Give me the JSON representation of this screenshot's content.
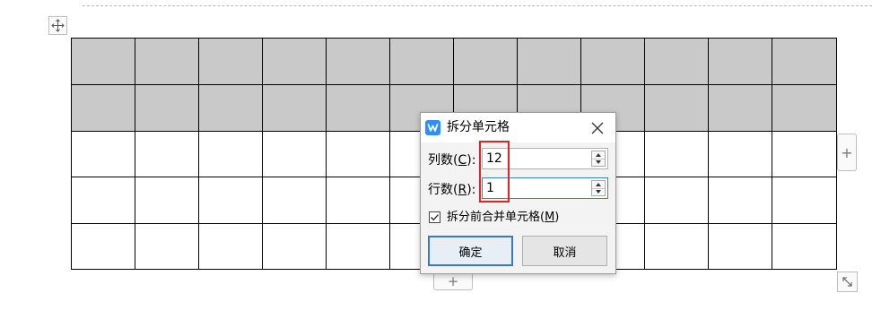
{
  "table": {
    "columns": 12,
    "rows": 5,
    "shaded_rows": 2,
    "shade_color": "#c9c9c9"
  },
  "handles": {
    "move_icon": "move-arrows-icon",
    "add_column_symbol": "+",
    "add_row_symbol": "+",
    "resize_icon": "resize-arrows-icon"
  },
  "dialog": {
    "title": "拆分单元格",
    "app_icon": "wps-writer-icon",
    "close_icon": "close-icon",
    "columns_label": "列数(",
    "columns_key": "C",
    "columns_label_end": "):",
    "columns_value": "12",
    "rows_label": "行数(",
    "rows_key": "R",
    "rows_label_end": "):",
    "rows_value": "1",
    "merge_label_prefix": "拆分前合并单元格(",
    "merge_key": "M",
    "merge_label_suffix": ")",
    "merge_checked": true,
    "ok_label": "确定",
    "cancel_label": "取消",
    "accent_color": "#2f8ef8",
    "highlight_color": "#e0242a"
  }
}
